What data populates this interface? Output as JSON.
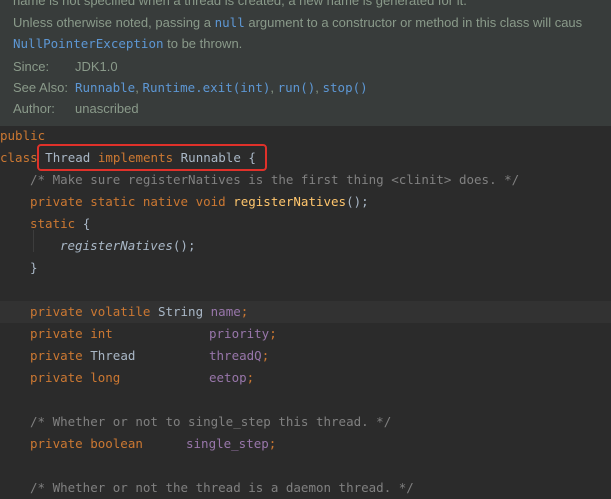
{
  "doc": {
    "line0": "name is not specified when a thread is created, a new name is generated for it.",
    "line1a": "Unless otherwise noted, passing a ",
    "line1b": "null",
    "line1c": " argument to a constructor or method in this class will caus",
    "line2a": "NullPointerException",
    "line2b": " to be thrown.",
    "since_label": "Since:",
    "since_value": "JDK1.0",
    "seealso_label": "See Also:",
    "seealso_links": [
      "Runnable",
      "Runtime.exit(int)",
      "run()",
      "stop()"
    ],
    "author_label": "Author:",
    "author_value": "unascribed"
  },
  "code": {
    "l1": "public",
    "l2_class": "class",
    "l2_name": "Thread",
    "l2_impl": "implements",
    "l2_iface": "Runnable",
    "l2_brace": "{",
    "l3": "/* Make sure registerNatives is the first thing <clinit> does. */",
    "l4_kw": "private static native void",
    "l4_fn": "registerNatives",
    "l4_end": "();",
    "l5_kw": "static",
    "l5_brace": "{",
    "l6_fn": "registerNatives",
    "l6_end": "();",
    "l7": "}",
    "f1_kw": "private volatile",
    "f1_type": "String",
    "f1_name": "name",
    "f2_kw": "private int",
    "f2_name": "priority",
    "f3_kw": "private",
    "f3_type": "Thread",
    "f3_name": "threadQ",
    "f4_kw": "private long",
    "f4_name": "eetop",
    "c2": "/* Whether or not to single_step this thread. */",
    "f5_kw": "private boolean",
    "f5_name": "single_step",
    "c3": "/* Whether or not the thread is a daemon thread. */",
    "semicolon": ";"
  }
}
